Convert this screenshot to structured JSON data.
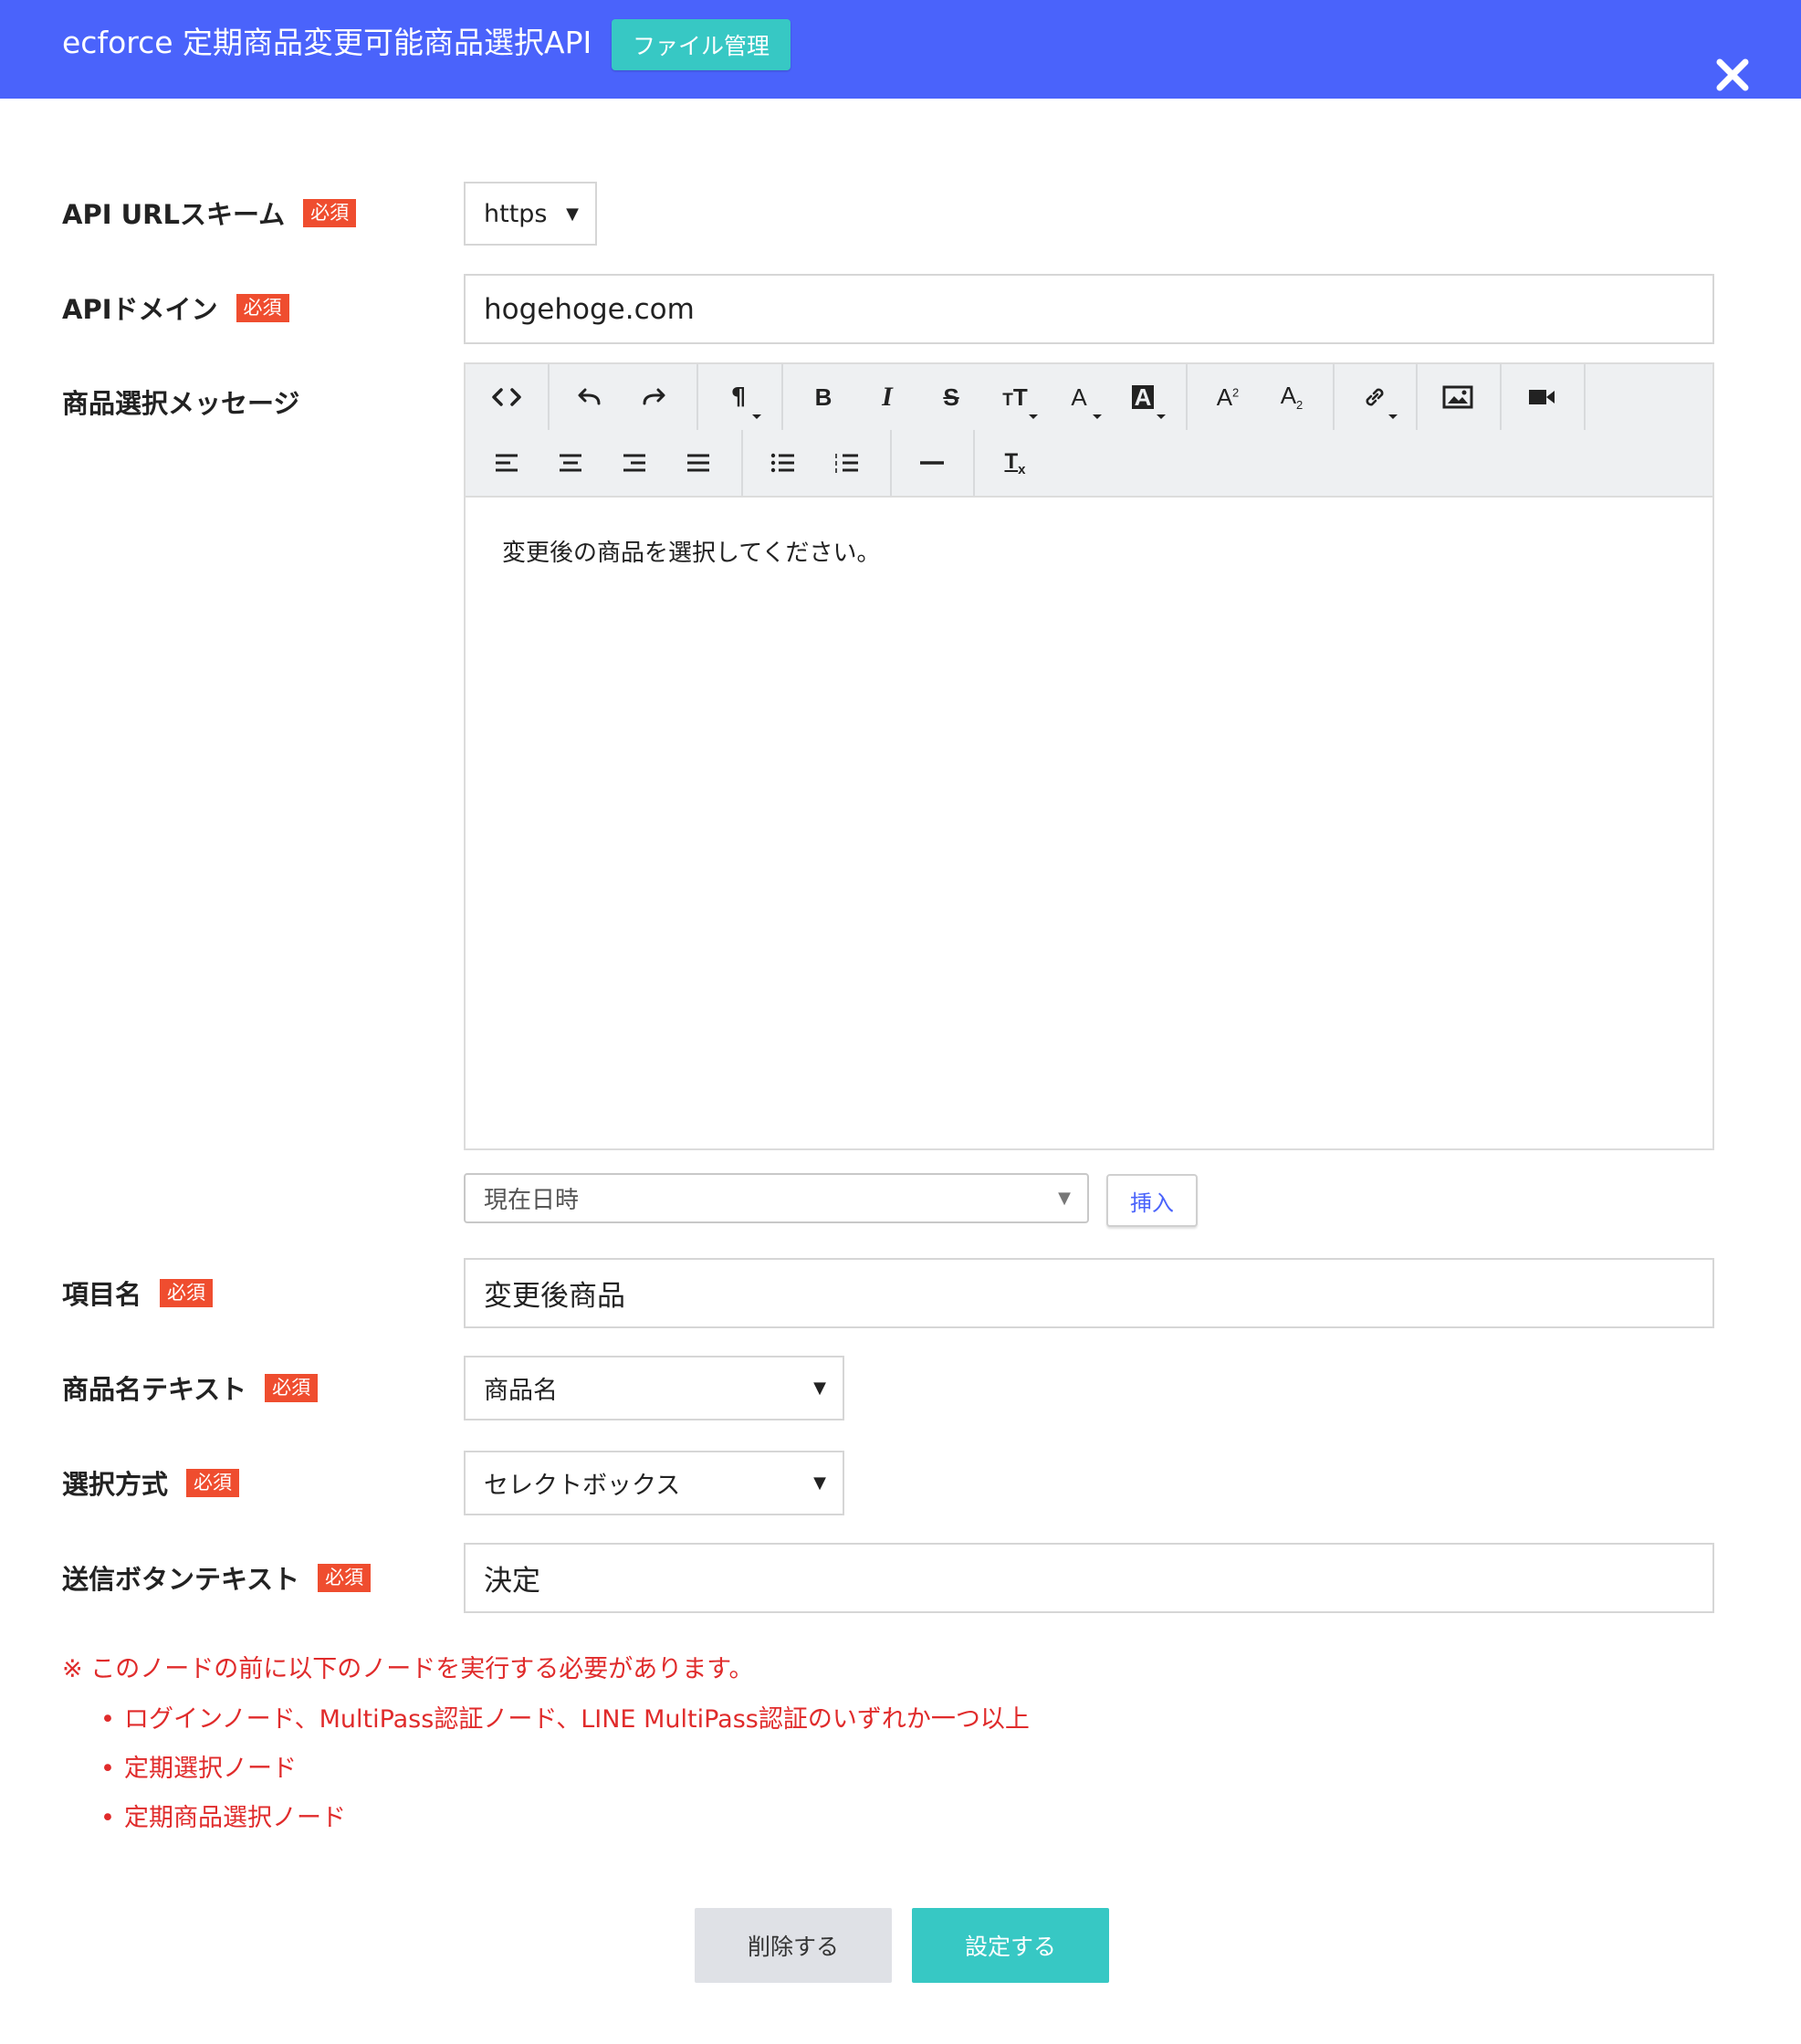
{
  "header": {
    "title": "ecforce 定期商品変更可能商品選択API",
    "file_button": "ファイル管理"
  },
  "form": {
    "required_badge": "必須",
    "scheme": {
      "label": "API URLスキーム",
      "value": "https"
    },
    "domain": {
      "label": "APIドメイン",
      "value": "hogehoge.com"
    },
    "message": {
      "label": "商品選択メッセージ",
      "content": "変更後の商品を選択してください。",
      "variable_select": "現在日時",
      "insert_button": "挿入"
    },
    "item_name": {
      "label": "項目名",
      "value": "変更後商品"
    },
    "product_name_text": {
      "label": "商品名テキスト",
      "value": "商品名"
    },
    "selection_method": {
      "label": "選択方式",
      "value": "セレクトボックス"
    },
    "submit_text": {
      "label": "送信ボタンテキスト",
      "value": "決定"
    }
  },
  "notice": {
    "heading": "※ このノードの前に以下のノードを実行する必要があります。",
    "items": [
      "ログインノード、MultiPass認証ノード、LINE MultiPass認証のいずれか一つ以上",
      "定期選択ノード",
      "定期商品選択ノード"
    ]
  },
  "actions": {
    "delete": "削除する",
    "set": "設定する"
  },
  "colors": {
    "header": "#4a63fb",
    "accent": "#37c8c4",
    "required": "#ef4d2f",
    "warning": "#e02b2b"
  }
}
